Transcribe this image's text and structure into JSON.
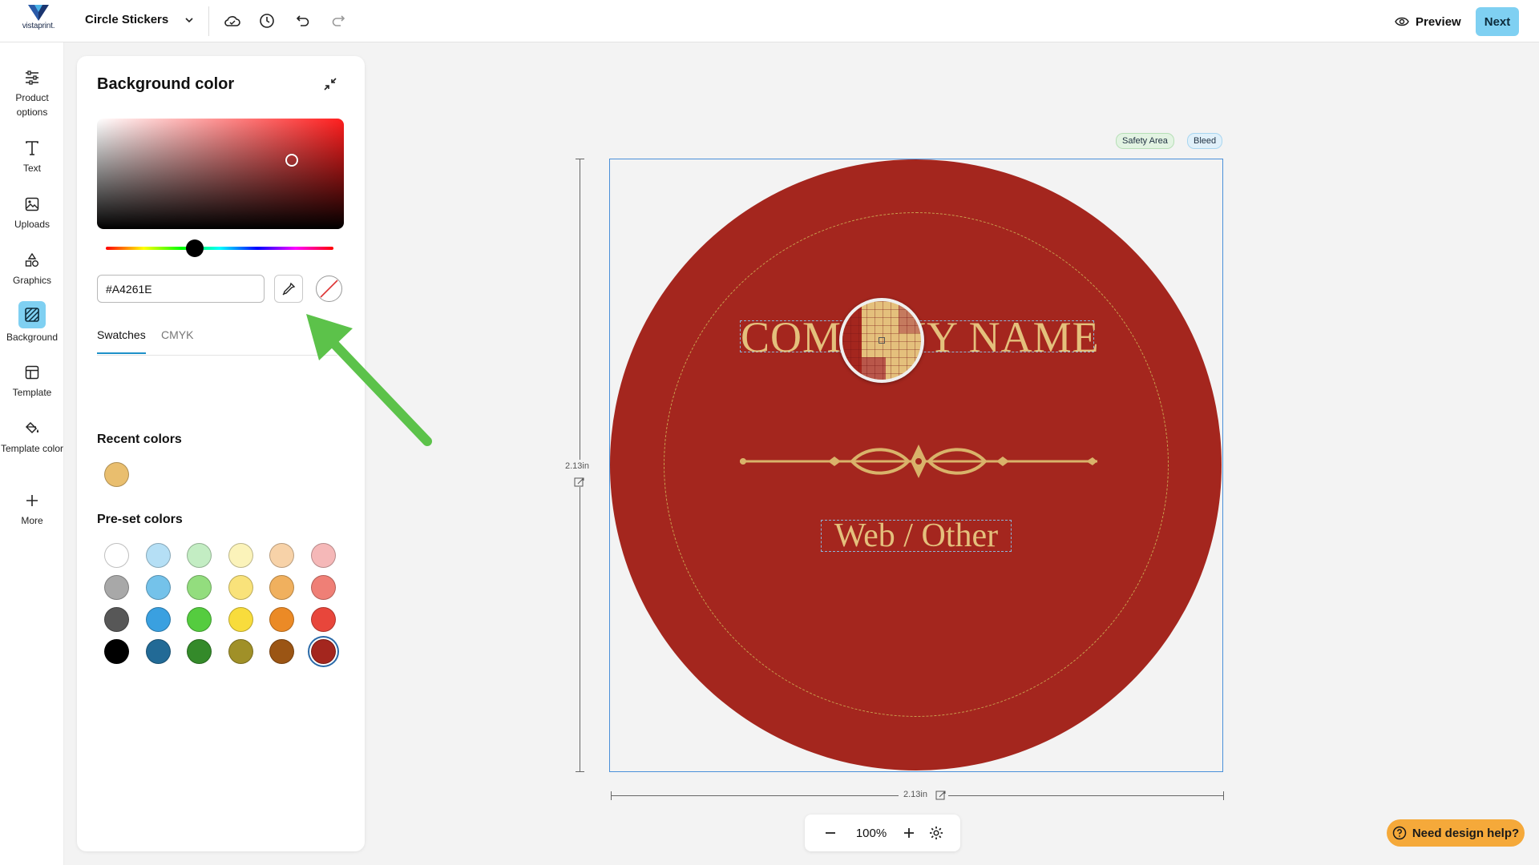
{
  "app": {
    "logo_text": "vistaprint.",
    "product_name": "Circle Stickers",
    "toolbar_icons": [
      "cloud-save-icon",
      "history-icon",
      "undo-icon",
      "redo-icon"
    ],
    "preview_label": "Preview",
    "next_label": "Next",
    "accent_color": "#7FD0F2"
  },
  "sidebar": {
    "items": [
      {
        "label": "Product options",
        "icon": "sliders-icon"
      },
      {
        "label": "Text",
        "icon": "text-icon"
      },
      {
        "label": "Uploads",
        "icon": "image-icon"
      },
      {
        "label": "Graphics",
        "icon": "shapes-icon"
      },
      {
        "label": "Background",
        "icon": "background-icon",
        "active": true
      },
      {
        "label": "Template",
        "icon": "template-icon"
      },
      {
        "label": "Template color",
        "icon": "paint-bucket-icon"
      },
      {
        "label": "More",
        "icon": "plus-icon"
      }
    ]
  },
  "panel": {
    "title": "Background color",
    "hex_value": "#A4261E",
    "tabs": [
      {
        "label": "Swatches",
        "active": true
      },
      {
        "label": "CMYK",
        "active": false
      }
    ],
    "recent_title": "Recent colors",
    "recent_colors": [
      "#E9BE6E"
    ],
    "preset_title": "Pre-set colors",
    "preset_colors": [
      [
        "#FFFFFF",
        "#B5DFF5",
        "#C3EDC3",
        "#FBF3BA",
        "#F7D2A8",
        "#F5B8B8"
      ],
      [
        "#A8A8A8",
        "#74C2EA",
        "#93DD7E",
        "#F9E27A",
        "#F0B05E",
        "#EF7F76"
      ],
      [
        "#575757",
        "#3AA0E0",
        "#55CC3F",
        "#F8DC3C",
        "#EB8A26",
        "#E8463B"
      ],
      [
        "#000000",
        "#226A96",
        "#348A2A",
        "#A09028",
        "#9B5514",
        "#A4261E"
      ]
    ],
    "selected_preset": "#A4261E"
  },
  "canvas": {
    "tags": [
      "Safety Area",
      "Bleed"
    ],
    "background_color": "#A4261E",
    "company_text": "COMPANY NAME",
    "web_text": "Web / Other",
    "text_color": "#E4C07C",
    "width_label": "2.13in",
    "height_label": "2.13in"
  },
  "zoom": {
    "value": "100%"
  },
  "help": {
    "label": "Need design help?"
  }
}
